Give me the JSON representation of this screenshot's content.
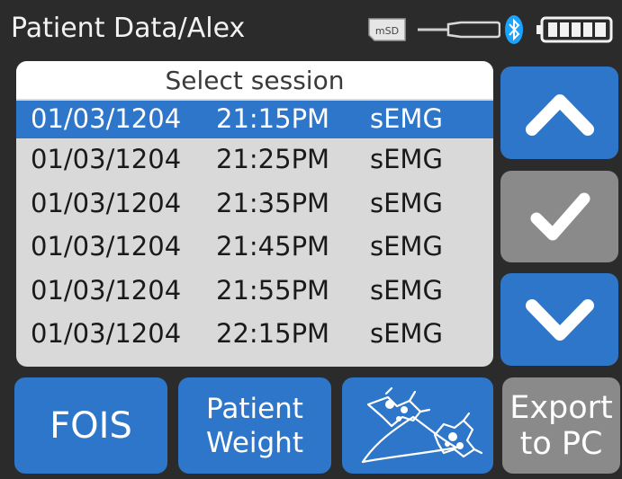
{
  "header": {
    "title": "Patient Data/Alex",
    "sd_icon_text": "mSD",
    "icons": [
      "sd-card-icon",
      "usb-sensor-icon",
      "bluetooth-icon",
      "battery-icon"
    ]
  },
  "sessions": {
    "header_label": "Select session",
    "rows": [
      {
        "date": "01/03/1204",
        "time": "21:15PM",
        "type": "sEMG",
        "selected": true
      },
      {
        "date": "01/03/1204",
        "time": "21:25PM",
        "type": "sEMG",
        "selected": false
      },
      {
        "date": "01/03/1204",
        "time": "21:35PM",
        "type": "sEMG",
        "selected": false
      },
      {
        "date": "01/03/1204",
        "time": "21:45PM",
        "type": "sEMG",
        "selected": false
      },
      {
        "date": "01/03/1204",
        "time": "21:55PM",
        "type": "sEMG",
        "selected": false
      },
      {
        "date": "01/03/1204",
        "time": "22:15PM",
        "type": "sEMG",
        "selected": false
      }
    ]
  },
  "side_buttons": {
    "up_icon": "chevron-up-icon",
    "confirm_icon": "check-icon",
    "down_icon": "chevron-down-icon"
  },
  "bottom_buttons": {
    "fois_label": "FOIS",
    "weight_line1": "Patient",
    "weight_line2": "Weight",
    "swallow_icon": "swallow-molecule-icon",
    "export_line1": "Export",
    "export_line2": "to PC"
  },
  "colors": {
    "background": "#2b2b2b",
    "accent_blue": "#2e76c9",
    "disabled_gray": "#8a8a8a",
    "list_bg": "#d9d9d9",
    "bluetooth": "#1aa3ff"
  }
}
